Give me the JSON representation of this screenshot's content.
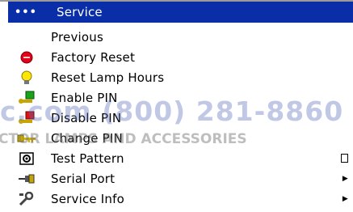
{
  "menu": {
    "header": {
      "dots": "•••",
      "label": "Service"
    },
    "items": [
      {
        "label": "Previous",
        "icon": "none"
      },
      {
        "label": "Factory Reset",
        "icon": "red-dot-icon"
      },
      {
        "label": "Reset Lamp Hours",
        "icon": "lamp-icon"
      },
      {
        "label": "Enable PIN",
        "icon": "enable-pin-icon"
      },
      {
        "label": "Disable PIN",
        "icon": "disable-pin-icon"
      },
      {
        "label": "Change PIN",
        "icon": "key-icon"
      },
      {
        "label": "Test Pattern",
        "icon": "test-pattern-icon",
        "end": "checkbox"
      },
      {
        "label": "Serial Port",
        "icon": "plug-icon",
        "end": "arrow"
      },
      {
        "label": "Service Info",
        "icon": "wrench-icon",
        "end": "arrow"
      }
    ]
  },
  "watermark": {
    "line1": "c.com (800) 281-8860",
    "line2": "CTOR LAMPS AND ACCESSORIES"
  },
  "colors": {
    "header_bg": "#0a2ea8",
    "header_text": "#ffffff"
  }
}
